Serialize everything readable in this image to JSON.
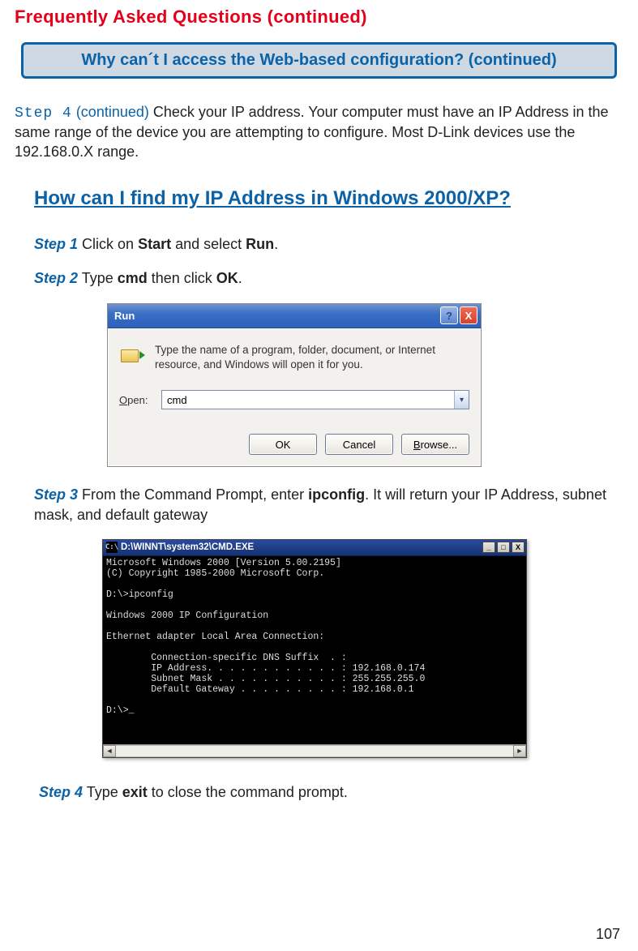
{
  "page": {
    "faq_title": "Frequently Asked Questions (continued)",
    "question_box": "Why can´t I access the Web-based configuration? (continued)",
    "step4_label": "Step 4",
    "continued_label": " (continued) ",
    "step4_text": "Check your IP address. Your computer must have an IP Address in the same range of the device you are attempting to configure. Most D-Link devices use the 192.168.0.X range.",
    "subheading": "How can I find my IP Address in Windows 2000/XP?",
    "page_number": "107"
  },
  "steps": {
    "s1": {
      "label": "Step 1",
      "pre": " Click on ",
      "b1": "Start",
      "mid": " and select ",
      "b2": "Run",
      "post": "."
    },
    "s2": {
      "label": "Step 2",
      "pre": " Type ",
      "b1": "cmd",
      "mid": " then click ",
      "b2": "OK",
      "post": "."
    },
    "s3": {
      "label": "Step 3",
      "pre": " From the Command Prompt, enter ",
      "b1": "ipconfig",
      "post": ". It will return your IP Address, subnet mask, and default gateway"
    },
    "s4": {
      "label": "Step 4",
      "pre": " Type ",
      "b1": "exit",
      "post": " to close the command prompt."
    }
  },
  "run_dialog": {
    "title": "Run",
    "help_glyph": "?",
    "close_glyph": "X",
    "desc": "Type the name of a program, folder, document, or Internet resource, and Windows will open it for you.",
    "open_label_u": "O",
    "open_label_rest": "pen:",
    "input_value": "cmd",
    "ok": "OK",
    "cancel": "Cancel",
    "browse_u": "B",
    "browse_rest": "rowse..."
  },
  "cmd": {
    "icon_glyph": "C:\\",
    "title": "D:\\WINNT\\system32\\CMD.EXE",
    "min": "_",
    "max": "□",
    "close": "X",
    "body": "Microsoft Windows 2000 [Version 5.00.2195]\n(C) Copyright 1985-2000 Microsoft Corp.\n\nD:\\>ipconfig\n\nWindows 2000 IP Configuration\n\nEthernet adapter Local Area Connection:\n\n        Connection-specific DNS Suffix  . :\n        IP Address. . . . . . . . . . . . : 192.168.0.174\n        Subnet Mask . . . . . . . . . . . : 255.255.255.0\n        Default Gateway . . . . . . . . . : 192.168.0.1\n\nD:\\>_"
  }
}
